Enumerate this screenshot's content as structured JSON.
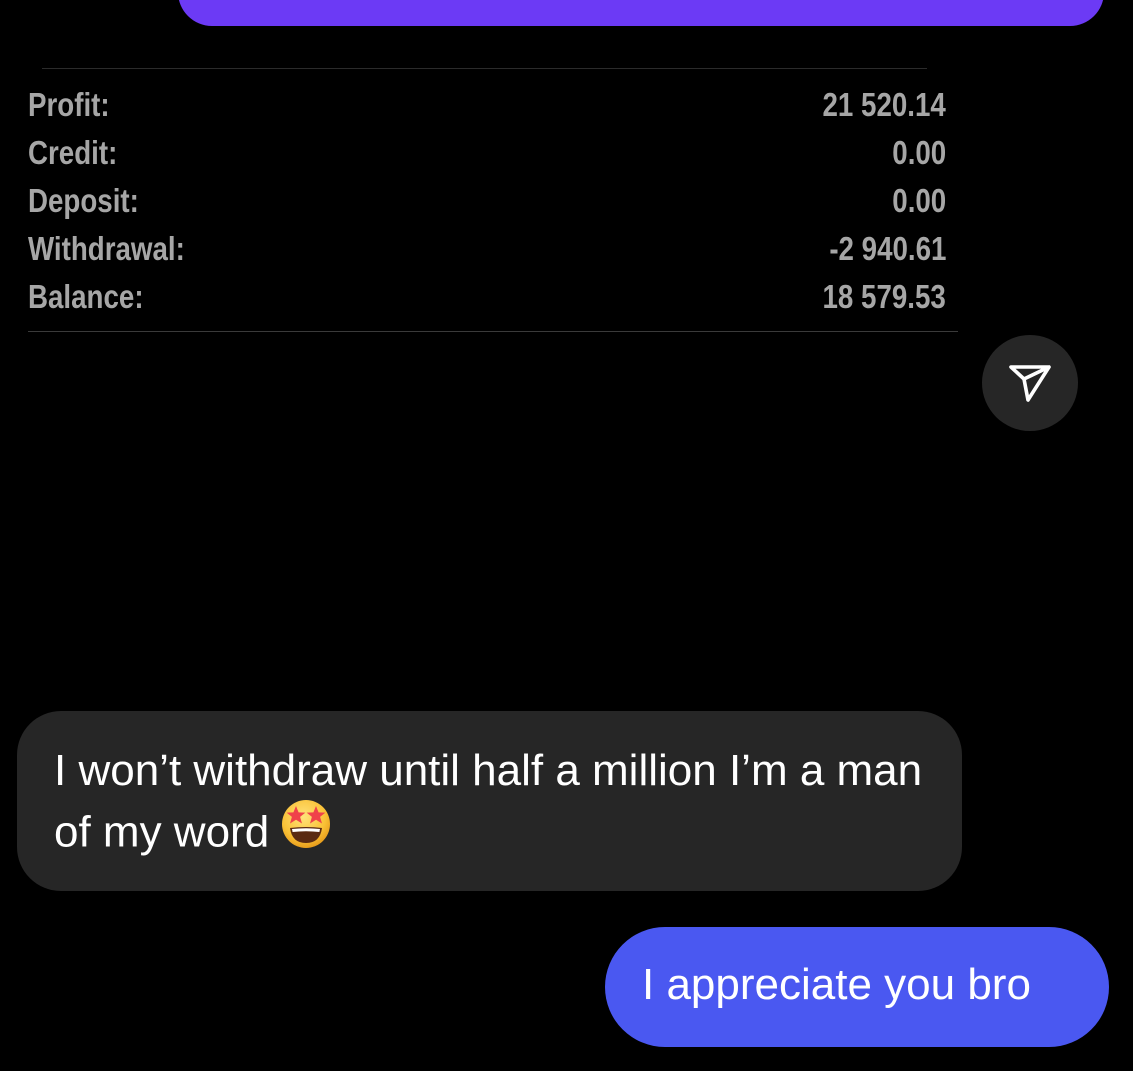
{
  "chat": {
    "statement": {
      "rows": [
        {
          "label": "Profit:",
          "value": "21 520.14"
        },
        {
          "label": "Credit:",
          "value": "0.00"
        },
        {
          "label": "Deposit:",
          "value": "0.00"
        },
        {
          "label": "Withdrawal:",
          "value": "-2 940.61"
        },
        {
          "label": "Balance:",
          "value": "18 579.53"
        }
      ]
    },
    "share_icon": "send-icon",
    "messages": [
      {
        "direction": "incoming",
        "text": "I won’t withdraw until half a million I’m a man of my word",
        "emoji": "star-struck-emoji"
      },
      {
        "direction": "outgoing",
        "text": "I appreciate you bro"
      }
    ]
  },
  "colors": {
    "background": "#000000",
    "outgoing_bubble": "#4a58f1",
    "previous_outgoing_bubble": "#6c3af5",
    "incoming_bubble": "#262626",
    "statement_text": "#a6a6a6",
    "message_text": "#ffffff"
  }
}
